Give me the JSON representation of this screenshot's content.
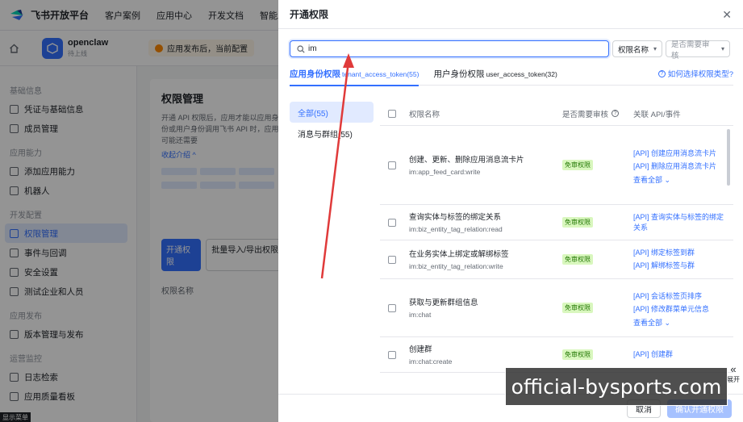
{
  "brand": {
    "name": "飞书开放平台"
  },
  "top_nav": [
    "客户案例",
    "应用中心",
    "开发文档",
    "智能助"
  ],
  "app": {
    "name": "openclaw",
    "status": "待上线"
  },
  "publish_tip": "应用发布后，当前配置",
  "sidebar": {
    "groups": [
      {
        "title": "基础信息",
        "items": [
          {
            "label": "凭证与基础信息"
          },
          {
            "label": "成员管理"
          }
        ]
      },
      {
        "title": "应用能力",
        "items": [
          {
            "label": "添加应用能力"
          },
          {
            "label": "机器人"
          }
        ]
      },
      {
        "title": "开发配置",
        "items": [
          {
            "label": "权限管理",
            "active": true
          },
          {
            "label": "事件与回调"
          },
          {
            "label": "安全设置"
          },
          {
            "label": "测试企业和人员"
          }
        ]
      },
      {
        "title": "应用发布",
        "items": [
          {
            "label": "版本管理与发布"
          }
        ]
      },
      {
        "title": "运营监控",
        "items": [
          {
            "label": "日志检索"
          },
          {
            "label": "应用质量看板"
          }
        ]
      }
    ],
    "menu_label": "显示菜单"
  },
  "content": {
    "title": "权限管理",
    "desc": "开通 API 权限后，应用才能以应用身份或用户身份调用飞书 API 时，应用可能还需要",
    "collapse": "收起介绍",
    "open_button": "开通权限",
    "import_button": "批量导入/导出权限",
    "table_col": "权限名称"
  },
  "drawer": {
    "title": "开通权限",
    "search": {
      "value": "im",
      "placeholder": ""
    },
    "select_name": "权限名称",
    "select_review": "是否需要审核",
    "tabs": [
      {
        "label": "应用身份权限",
        "code": "tenant_access_token(55)",
        "active": true
      },
      {
        "label": "用户身份权限",
        "code": "user_access_token(32)",
        "active": false
      }
    ],
    "help_link": "如何选择权限类型?",
    "categories": [
      {
        "label": "全部(55)",
        "active": true
      },
      {
        "label": "消息与群组(55)",
        "active": false
      }
    ],
    "table": {
      "headers": {
        "name": "权限名称",
        "review": "是否需要审核",
        "api": "关联 API/事件"
      },
      "rows": [
        {
          "title": "创建、更新、删除应用消息流卡片",
          "code": "im:app_feed_card:write",
          "badge": "免审权限",
          "apis": [
            "[API] 创建应用消息流卡片",
            "[API] 删除应用消息流卡片"
          ],
          "more": "查看全部"
        },
        {
          "title": "查询实体与标签的绑定关系",
          "code": "im:biz_entity_tag_relation:read",
          "badge": "免审权限",
          "apis": [
            "[API] 查询实体与标签的绑定关系"
          ],
          "more": ""
        },
        {
          "title": "在业务实体上绑定或解绑标签",
          "code": "im:biz_entity_tag_relation:write",
          "badge": "免审权限",
          "apis": [
            "[API] 绑定标签到群",
            "[API] 解绑标签与群"
          ],
          "more": ""
        },
        {
          "title": "获取与更新群组信息",
          "code": "im:chat",
          "badge": "免审权限",
          "apis": [
            "[API] 会话标签页排序",
            "[API] 修改群菜单元信息"
          ],
          "more": "查看全部"
        },
        {
          "title": "创建群",
          "code": "im:chat:create",
          "badge": "免审权限",
          "apis": [
            "[API] 创建群"
          ],
          "more": ""
        }
      ]
    },
    "footer": {
      "cancel": "取消",
      "confirm": "确认开通权限"
    },
    "expand_label": "展开"
  },
  "watermark": "official-bysports.com",
  "colors": {
    "accent": "#3370ff",
    "annotation_arrow": "#e03a3a",
    "badge_bg": "#d9f7be"
  }
}
